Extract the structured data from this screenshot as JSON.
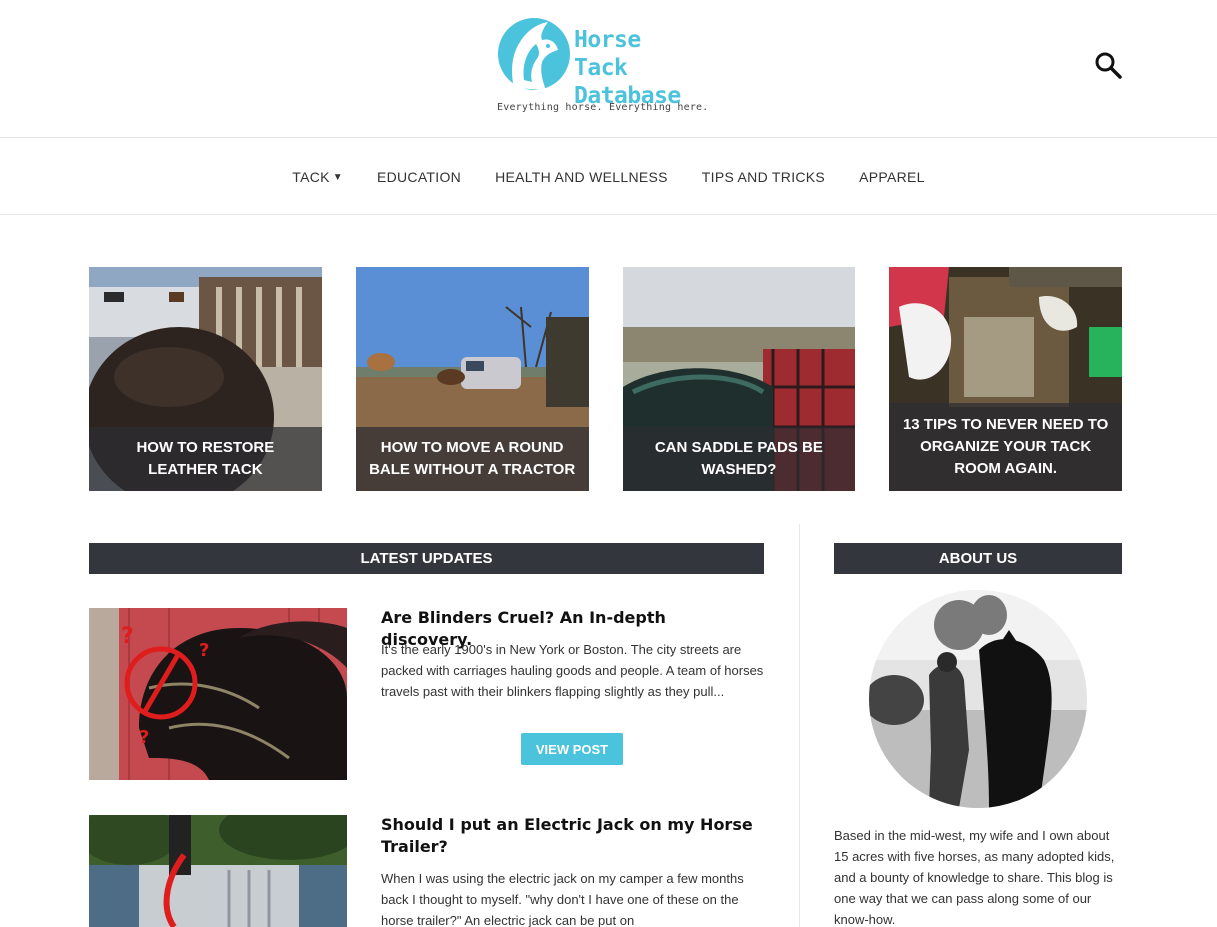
{
  "header": {
    "logo_line1": "Horse Tack",
    "logo_line2": "Database",
    "tagline": "Everything horse. Everything here.",
    "search_icon": "search-icon"
  },
  "nav": {
    "items": [
      {
        "label": "TACK",
        "has_dropdown": true
      },
      {
        "label": "EDUCATION"
      },
      {
        "label": "HEALTH AND WELLNESS"
      },
      {
        "label": "TIPS AND TRICKS"
      },
      {
        "label": "APPAREL"
      }
    ]
  },
  "featured": [
    {
      "title": "HOW TO RESTORE LEATHER TACK"
    },
    {
      "title": "HOW TO MOVE A ROUND BALE WITHOUT A TRACTOR"
    },
    {
      "title": "CAN SADDLE PADS BE WASHED?"
    },
    {
      "title": "13 TIPS TO NEVER NEED TO ORGANIZE YOUR TACK ROOM AGAIN."
    }
  ],
  "latest": {
    "heading": "LATEST UPDATES",
    "posts": [
      {
        "title": "Are Blinders Cruel? An In-depth discovery.",
        "excerpt": "It's the early 1900's in New York or Boston. The city streets are packed with carriages hauling goods and people. A team of horses travels past with their blinkers flapping slightly as they pull...",
        "button": "VIEW POST"
      },
      {
        "title": "Should I put an Electric Jack on my Horse Trailer?",
        "excerpt": "When I was using the electric jack on my camper a few months back I thought to myself. \"why don't I have one of these on the horse trailer?\" An electric jack can be put on"
      }
    ]
  },
  "about": {
    "heading": "ABOUT US",
    "text": "Based in the mid-west, my wife and I own about 15 acres with five horses, as many adopted kids, and a bounty of knowledge to share. This blog is one way that we can pass along some of our know-how."
  },
  "colors": {
    "accent": "#4cc3dc",
    "bar": "#34363d"
  }
}
